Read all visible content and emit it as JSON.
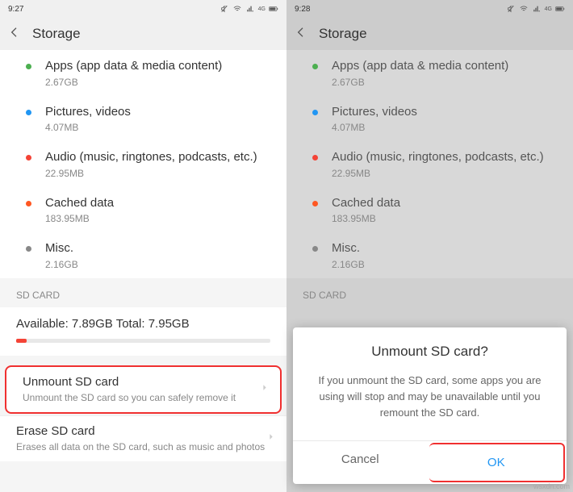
{
  "left": {
    "time": "9:27",
    "header": "Storage",
    "items": [
      {
        "title": "Apps (app data & media content)",
        "sub": "2.67GB",
        "dot": "green"
      },
      {
        "title": "Pictures, videos",
        "sub": "4.07MB",
        "dot": "blue"
      },
      {
        "title": "Audio (music, ringtones, podcasts, etc.)",
        "sub": "22.95MB",
        "dot": "red"
      },
      {
        "title": "Cached data",
        "sub": "183.95MB",
        "dot": "orange"
      },
      {
        "title": "Misc.",
        "sub": "2.16GB",
        "dot": "gray"
      }
    ],
    "sd_label": "SD CARD",
    "sd_avail": "Available: 7.89GB   Total: 7.95GB",
    "unmount": {
      "title": "Unmount SD card",
      "desc": "Unmount the SD card so you can safely remove it"
    },
    "erase": {
      "title": "Erase SD card",
      "desc": "Erases all data on the SD card, such as music and photos"
    }
  },
  "right": {
    "time": "9:28",
    "header": "Storage",
    "items": [
      {
        "title": "Apps (app data & media content)",
        "sub": "2.67GB",
        "dot": "green"
      },
      {
        "title": "Pictures, videos",
        "sub": "4.07MB",
        "dot": "blue"
      },
      {
        "title": "Audio (music, ringtones, podcasts, etc.)",
        "sub": "22.95MB",
        "dot": "red"
      },
      {
        "title": "Cached data",
        "sub": "183.95MB",
        "dot": "orange"
      },
      {
        "title": "Misc.",
        "sub": "2.16GB",
        "dot": "gray"
      }
    ],
    "sd_label": "SD CARD",
    "dialog": {
      "title": "Unmount SD card?",
      "msg": "If you unmount the SD card, some apps you are using will stop and may be unavailable until you remount the SD card.",
      "cancel": "Cancel",
      "ok": "OK"
    }
  },
  "watermark": "wsxdn.com"
}
